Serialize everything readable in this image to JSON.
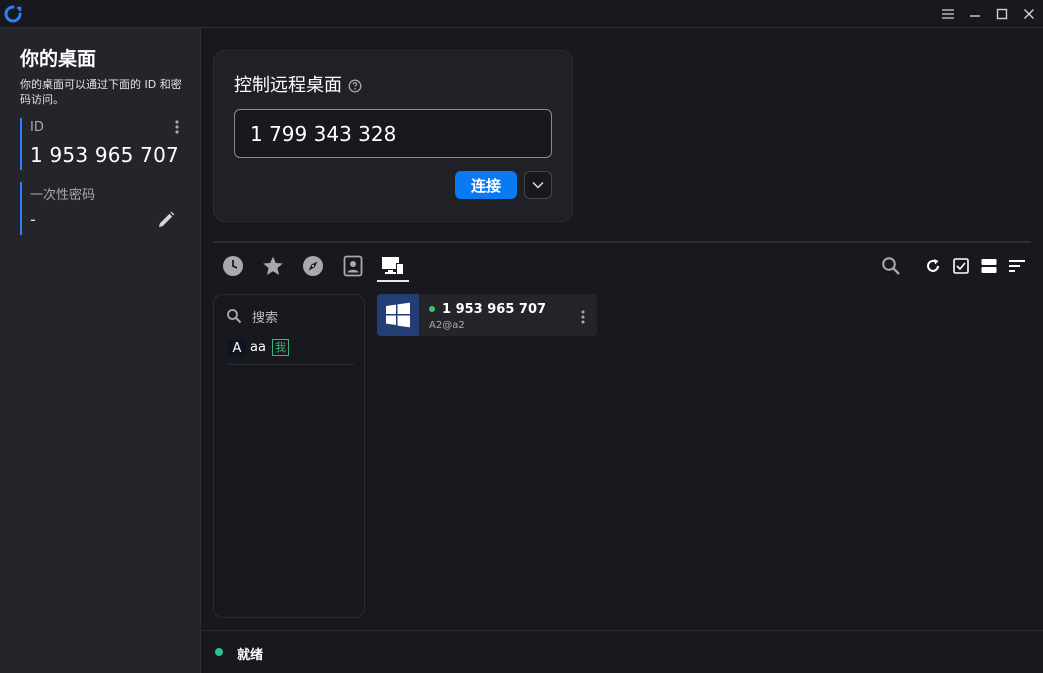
{
  "titlebar": {
    "buttons": [
      "menu",
      "minimize",
      "maximize",
      "close"
    ]
  },
  "left_panel": {
    "title": "你的桌面",
    "description": "你的桌面可以通过下面的 ID 和密码访问。",
    "id_label": "ID",
    "id_value": "1 953 965 707",
    "password_label": "一次性密码",
    "password_value": "-"
  },
  "connect": {
    "title": "控制远程桌面",
    "remote_id": "1 799 343 328",
    "connect_label": "连接"
  },
  "tabs": [
    {
      "icon": "clock-icon",
      "name": "recent"
    },
    {
      "icon": "star-icon",
      "name": "favorites"
    },
    {
      "icon": "compass-icon",
      "name": "discovered"
    },
    {
      "icon": "contact-icon",
      "name": "address-book"
    },
    {
      "icon": "devices-icon",
      "name": "my-devices",
      "active": true
    }
  ],
  "address_book": {
    "search_placeholder": "搜索",
    "tag": {
      "avatar": "A",
      "name": "aa",
      "me": "我"
    }
  },
  "peer": {
    "id": "1 953 965 707",
    "alias": "A2@a2",
    "os": "windows",
    "online": true
  },
  "status": {
    "text": "就绪"
  },
  "colors": {
    "accent": "#0a7af3",
    "online": "#3cc36b",
    "ready": "#2bbf8f",
    "me_tag": "#3ab57e"
  }
}
